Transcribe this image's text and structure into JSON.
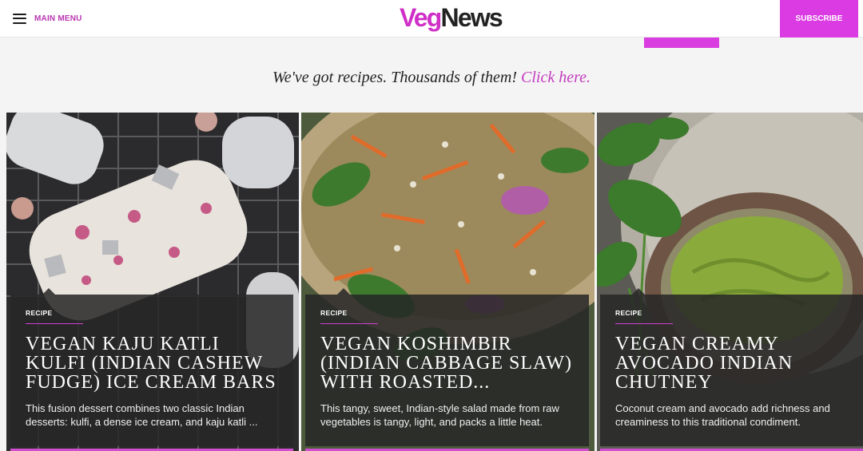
{
  "header": {
    "menu_label": "MAIN MENU",
    "logo_veg": "Veg",
    "logo_news": "News",
    "subscribe_label": "SUBSCRIBE"
  },
  "tagline": {
    "text": "We've got recipes. Thousands of them! ",
    "link": "Click here."
  },
  "colors": {
    "brand": "#cf2fc7",
    "subscribe_bg": "#db3be2",
    "panel_bg": "#262626"
  },
  "cards": [
    {
      "badge": "RECIPE",
      "title": "VEGAN KAJU KATLI KULFI (INDIAN CASHEW FUDGE) ICE CREAM BARS",
      "description": "This fusion dessert combines two classic Indian desserts: kulfi, a dense ice cream, and kaju katli ..."
    },
    {
      "badge": "RECIPE",
      "title": "VEGAN KOSHIMBIR (INDIAN CABBAGE SLAW) WITH ROASTED...",
      "description": "This tangy, sweet, Indian-style salad made from raw vegetables is tangy, light, and packs a little heat."
    },
    {
      "badge": "RECIPE",
      "title": "VEGAN CREAMY AVOCADO INDIAN CHUTNEY",
      "description": "Coconut cream and avocado add richness and creaminess to this traditional condiment."
    }
  ]
}
